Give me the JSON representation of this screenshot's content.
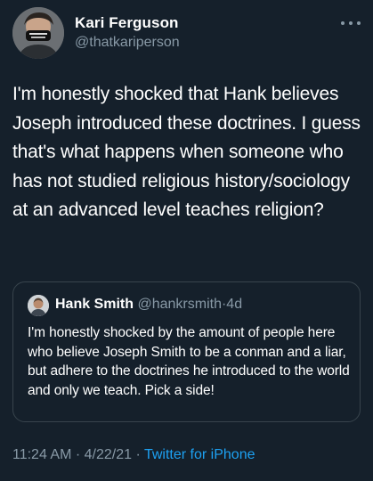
{
  "author": {
    "name": "Kari Ferguson",
    "handle": "@thatkariperson",
    "avatar_icon": "profile-photo-masked"
  },
  "tweet": {
    "text": "I'm honestly shocked that Hank believes Joseph introduced these doctrines. I guess that's what happens when someone who has not studied religious history/sociology at an advanced level teaches religion?"
  },
  "quoted": {
    "name": "Hank Smith",
    "handle": "@hankrsmith",
    "separator": "·",
    "time": "4d",
    "text": "I'm honestly shocked by the amount of people here who believe Joseph Smith to be a conman and a liar, but adhere to the doctrines he introduced to the world and only we teach. Pick a side!",
    "avatar_icon": "profile-photo"
  },
  "meta": {
    "time": "11:24 AM",
    "sep1": "·",
    "date": "4/22/21",
    "sep2": "·",
    "source": "Twitter for iPhone"
  },
  "colors": {
    "background": "#15202b",
    "text": "#ffffff",
    "secondary": "#8899a6",
    "link": "#1da1f2",
    "border": "#38444d"
  },
  "icons": {
    "more": "more-options-icon"
  }
}
